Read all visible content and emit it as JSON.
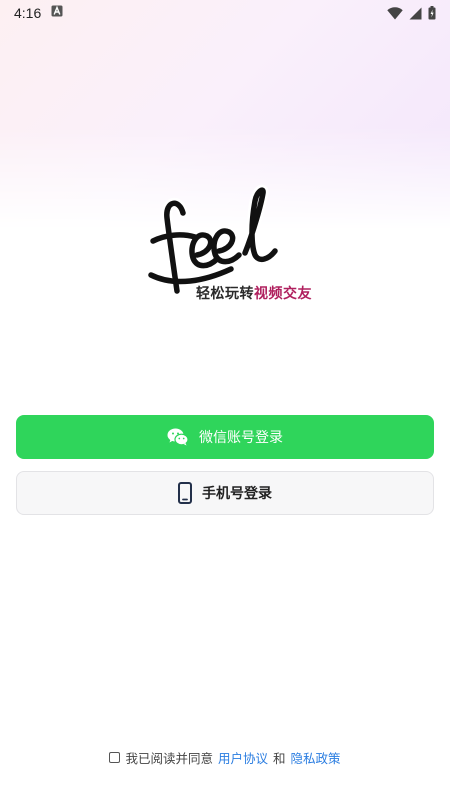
{
  "status_bar": {
    "time": "4:16",
    "icons": [
      "notification-a-icon",
      "wifi-icon",
      "cell-signal-icon",
      "battery-icon"
    ]
  },
  "logo": {
    "text": "feel",
    "tagline_part1": "轻松玩转",
    "tagline_part2": "视频交友"
  },
  "buttons": {
    "wechat_label": "微信账号登录",
    "phone_label": "手机号登录"
  },
  "agreement": {
    "prefix": "我已阅读并同意",
    "user_agreement": "用户协议",
    "and": "和",
    "privacy_policy": "隐私政策",
    "checked": false
  },
  "colors": {
    "wechat_green": "#2fd55b",
    "link_blue": "#2a7de1",
    "tagline_accent": "#b0205e"
  }
}
